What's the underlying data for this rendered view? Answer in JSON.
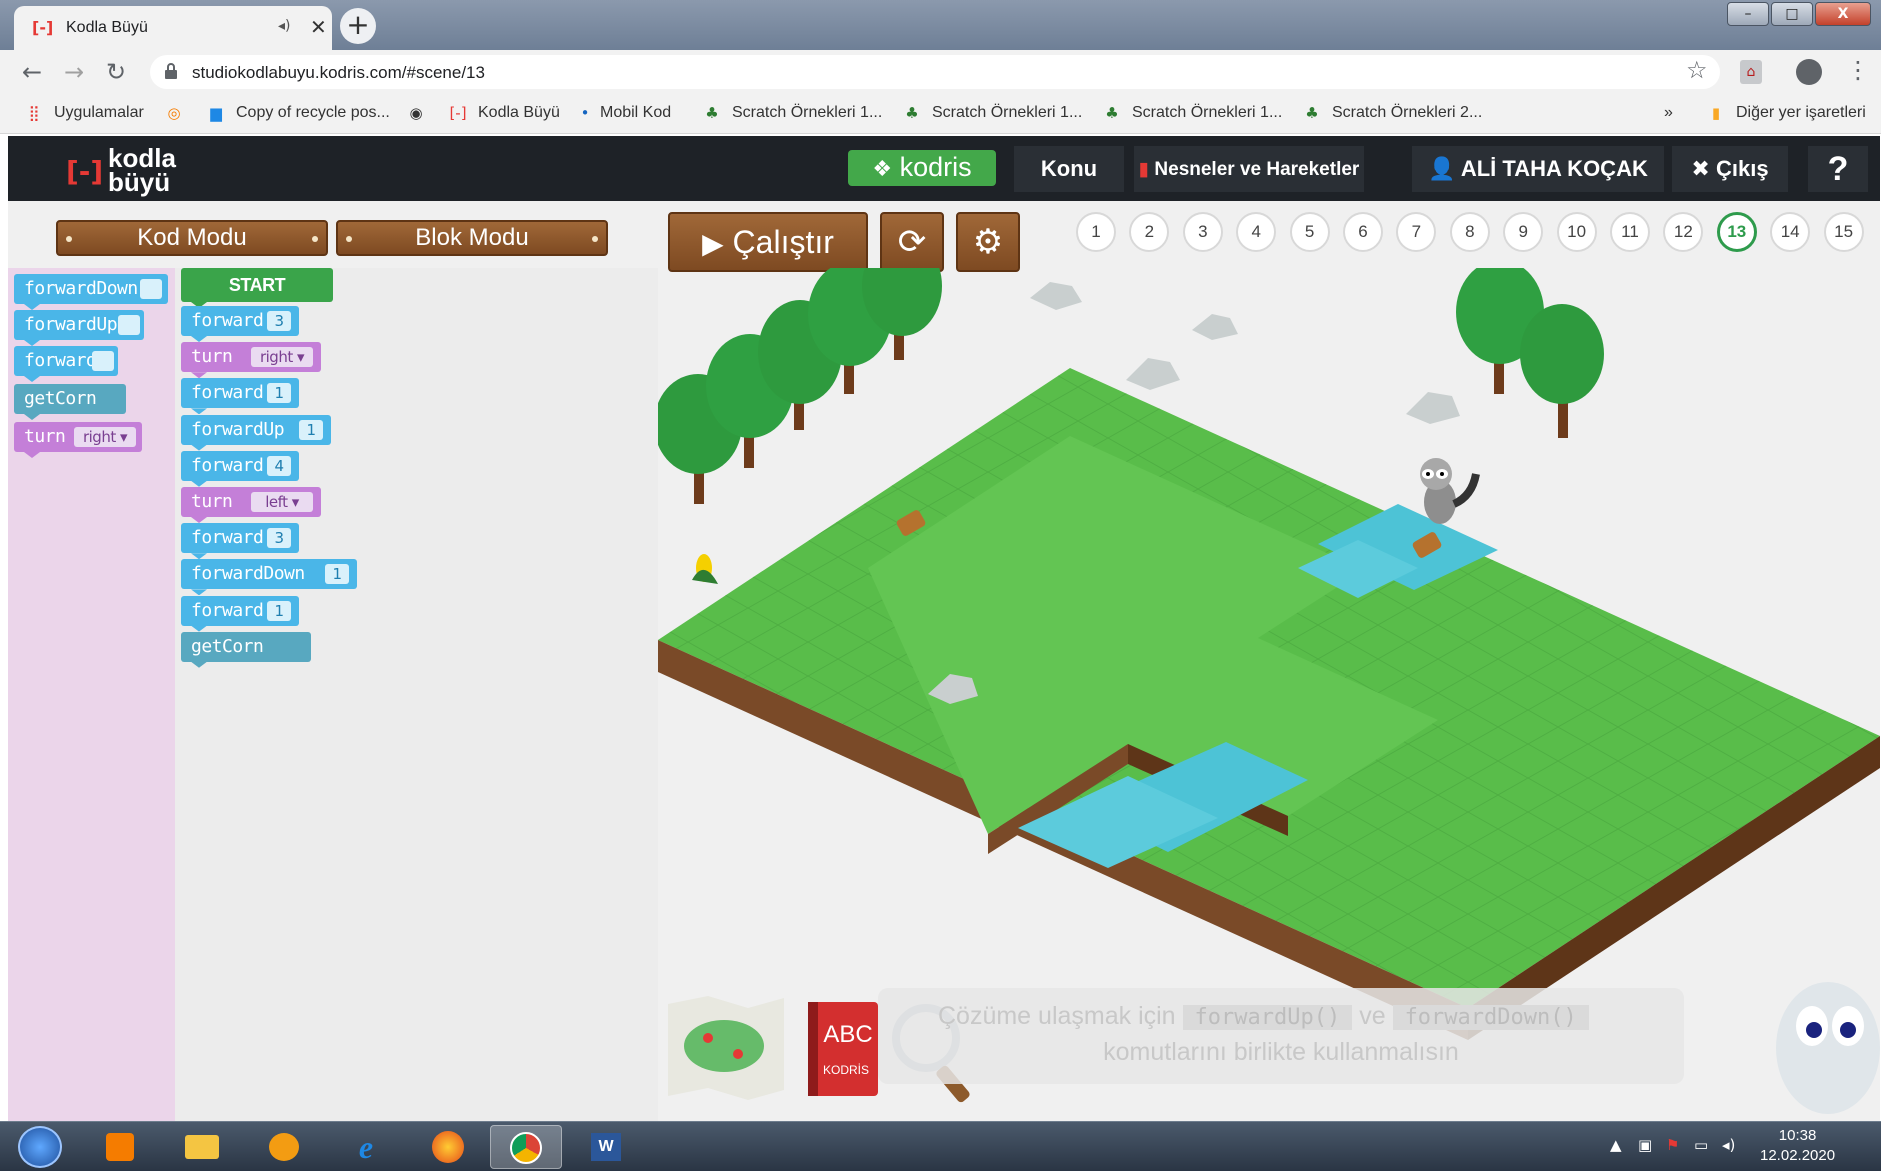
{
  "browser": {
    "tab_title": "Kodla Büyü",
    "url": "studiokodlabuyu.kodris.com/#scene/13",
    "bookmarks": [
      {
        "label": "Uygulamalar",
        "icon": "apps-grid-icon"
      },
      {
        "label": "",
        "icon": "circle-logo-icon"
      },
      {
        "label": "Copy of recycle pos...",
        "icon": "doc-icon"
      },
      {
        "label": "",
        "icon": "globe-icon"
      },
      {
        "label": "Kodla Büyü",
        "icon": "kodla-buyu-icon"
      },
      {
        "label": "Mobil Kod",
        "icon": "dot-icon"
      },
      {
        "label": "Scratch Örnekleri 1...",
        "icon": "scratch-icon"
      },
      {
        "label": "Scratch Örnekleri 1...",
        "icon": "scratch-icon"
      },
      {
        "label": "Scratch Örnekleri 1...",
        "icon": "scratch-icon"
      },
      {
        "label": "Scratch Örnekleri 2...",
        "icon": "scratch-icon"
      }
    ],
    "bookmarks_more": "»",
    "other_bookmarks": "Diğer yer işaretleri"
  },
  "header": {
    "logo_line1": "kodla",
    "logo_line2": "büyü",
    "brand": "kodris",
    "konu_label": "Konu",
    "topic": "Nesneler ve Hareketler",
    "user": "ALİ TAHA KOÇAK",
    "logout": "Çıkış",
    "help": "?"
  },
  "modes": {
    "code_mode": "Kod Modu",
    "block_mode": "Blok Modu"
  },
  "controls": {
    "run": "Çalıştır"
  },
  "levels": [
    "1",
    "2",
    "3",
    "4",
    "5",
    "6",
    "7",
    "8",
    "9",
    "10",
    "11",
    "12",
    "13",
    "14",
    "15"
  ],
  "current_level": "13",
  "palette": [
    {
      "label": "forwardDown",
      "type": "blue",
      "slot": ""
    },
    {
      "label": "forwardUp",
      "type": "blue",
      "slot": ""
    },
    {
      "label": "forward",
      "type": "blue",
      "slot": ""
    },
    {
      "label": "getCorn",
      "type": "teal"
    },
    {
      "label": "turn",
      "type": "purple",
      "slot": "right"
    }
  ],
  "program": {
    "start": "START",
    "blocks": [
      {
        "label": "forward",
        "type": "blue",
        "slot": "3"
      },
      {
        "label": "turn",
        "type": "purple",
        "slot": "right"
      },
      {
        "label": "forward",
        "type": "blue",
        "slot": "1"
      },
      {
        "label": "forwardUp",
        "type": "blue",
        "slot": "1"
      },
      {
        "label": "forward",
        "type": "blue",
        "slot": "4"
      },
      {
        "label": "turn",
        "type": "purple",
        "slot": "left"
      },
      {
        "label": "forward",
        "type": "blue",
        "slot": "3"
      },
      {
        "label": "forwardDown",
        "type": "blue",
        "slot": "1"
      },
      {
        "label": "forward",
        "type": "blue",
        "slot": "1"
      },
      {
        "label": "getCorn",
        "type": "teal"
      }
    ]
  },
  "hint": {
    "part1": "Çözüme ulaşmak için",
    "code1": "forwardUp()",
    "part2": "ve",
    "code2": "forwardDown()",
    "line2": "komutlarını birlikte kullanmalısın"
  },
  "book_label": "ABC",
  "book_sub": "KODRİS",
  "clock": {
    "time": "10:38",
    "date": "12.02.2020"
  },
  "colors": {
    "header_bg": "#1e2227",
    "kodris_green": "#43a84a",
    "active_level": "#2e9b4c",
    "block_blue": "#4ab6e8",
    "block_purple": "#c47fd8",
    "block_teal": "#58a8c0",
    "palette_bg": "#ebd5ea",
    "grass": "#5cc04e",
    "water": "#4dc3d6"
  }
}
